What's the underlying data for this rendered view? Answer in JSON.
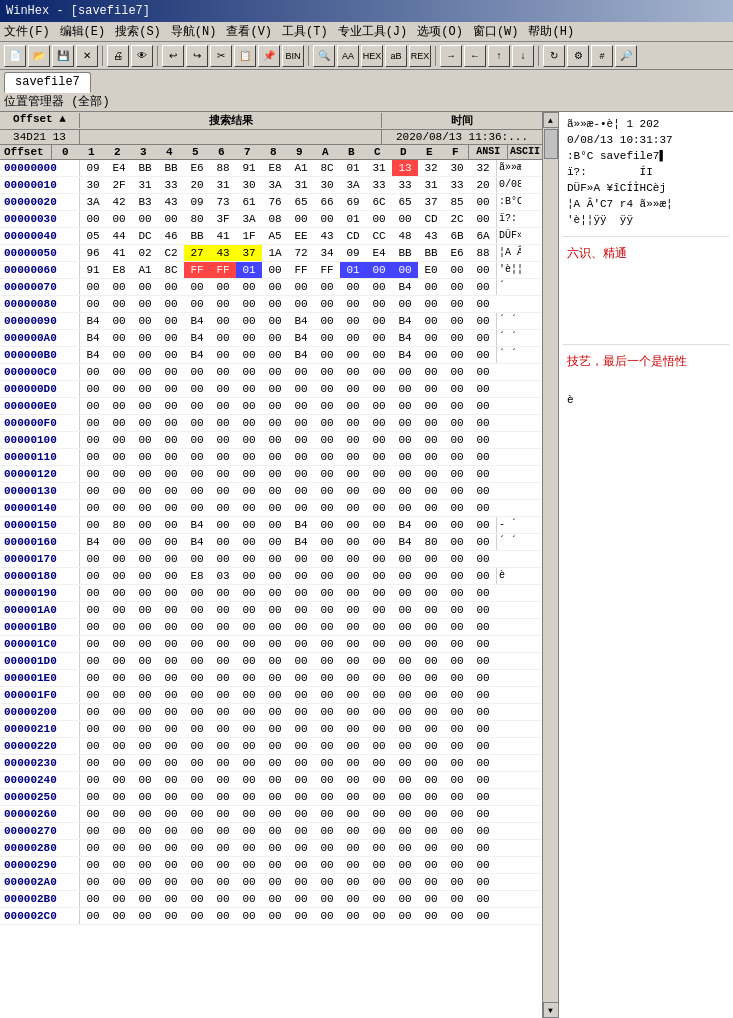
{
  "window": {
    "title": "WinHex - [savefile7]",
    "icon": "📄"
  },
  "menu": {
    "items": [
      "文件(F)",
      "编辑(E)",
      "搜索(S)",
      "导航(N)",
      "查看(V)",
      "工具(T)",
      "专业工具(J)",
      "选项(O)",
      "窗口(W)",
      "帮助(H)"
    ]
  },
  "tab": {
    "label": "savefile7"
  },
  "location_bar": {
    "label": "位置管理器 (全部)"
  },
  "header": {
    "offset_label": "Offset ▲",
    "search_label": "搜索结果",
    "time_label": "时间"
  },
  "subheader": {
    "offset_val": "34D21 13",
    "time_val": "2020/08/13  11:36:..."
  },
  "col_headers": [
    "0",
    "1",
    "2",
    "3",
    "4",
    "5",
    "6",
    "7",
    "8",
    "9",
    "A",
    "B",
    "C",
    "D",
    "E",
    "F"
  ],
  "ansi_label": "ANSI",
  "ascii_label": "ASCII",
  "rows": [
    {
      "offset": "00000000",
      "bytes": [
        "09",
        "E4",
        "BB",
        "BB",
        "E6",
        "88",
        "91",
        "E8",
        "A1",
        "8C",
        "01",
        "31",
        "13",
        "32",
        "30",
        "32"
      ],
      "ansi": "ã»»æ‐•è¦ 1 202",
      "ascii": ""
    },
    {
      "offset": "00000010",
      "bytes": [
        "30",
        "2F",
        "31",
        "33",
        "20",
        "31",
        "30",
        "3A",
        "31",
        "30",
        "3A",
        "33",
        "33",
        "31",
        "33",
        "20"
      ],
      "ansi": "0/08/13 10:31:37",
      "ascii": ""
    },
    {
      "offset": "00000020",
      "bytes": [
        "3A",
        "42",
        "B3",
        "43",
        "09",
        "73",
        "61",
        "76",
        "65",
        "66",
        "69",
        "6C",
        "65",
        "37",
        "85",
        "00"
      ],
      "ansi": ":B°C savefile7▌",
      "ascii": ""
    },
    {
      "offset": "00000030",
      "bytes": [
        "00",
        "00",
        "00",
        "00",
        "80",
        "3F",
        "3A",
        "08",
        "00",
        "00",
        "01",
        "00",
        "00",
        "CD",
        "2C",
        "00"
      ],
      "ansi": "ï?:        ÍI",
      "ascii": ""
    },
    {
      "offset": "00000040",
      "bytes": [
        "05",
        "44",
        "DC",
        "46",
        "BB",
        "41",
        "1F",
        "A5",
        "EE",
        "43",
        "CD",
        "CC",
        "48",
        "43",
        "6B",
        "6A"
      ],
      "ansi": "DÜF»A ¥îCÍÌHCèj",
      "ascii": ""
    },
    {
      "offset": "00000050",
      "bytes": [
        "96",
        "41",
        "02",
        "C2",
        "27",
        "43",
        "37",
        "1A",
        "72",
        "34",
        "09",
        "E4",
        "BB",
        "BB",
        "E6",
        "88"
      ],
      "ansi": "¦A Â'C7 r4 ã»»æ¦",
      "ascii": ""
    },
    {
      "offset": "00000060",
      "bytes": [
        "91",
        "E8",
        "A1",
        "8C",
        "FF",
        "FF",
        "01",
        "00",
        "FF",
        "FF",
        "01",
        "00",
        "00",
        "E0",
        "00",
        "00"
      ],
      "ansi": "'è¦¦ÿÿ  ÿÿ  à  ",
      "ascii": ""
    },
    {
      "offset": "00000070",
      "bytes": [
        "00",
        "00",
        "00",
        "00",
        "00",
        "00",
        "00",
        "00",
        "00",
        "00",
        "00",
        "00",
        "B4",
        "00",
        "00",
        "00"
      ],
      "ansi": "            ´   ",
      "ascii": ""
    },
    {
      "offset": "00000080",
      "bytes": [
        "00",
        "00",
        "00",
        "00",
        "00",
        "00",
        "00",
        "00",
        "00",
        "00",
        "00",
        "00",
        "00",
        "00",
        "00",
        "00"
      ],
      "ansi": "                ",
      "ascii": ""
    },
    {
      "offset": "00000090",
      "bytes": [
        "B4",
        "00",
        "00",
        "00",
        "B4",
        "00",
        "00",
        "00",
        "B4",
        "00",
        "00",
        "00",
        "B4",
        "00",
        "00",
        "00"
      ],
      "ansi": "´   ´   ´   ´   ",
      "ascii": ""
    },
    {
      "offset": "000000A0",
      "bytes": [
        "B4",
        "00",
        "00",
        "00",
        "B4",
        "00",
        "00",
        "00",
        "B4",
        "00",
        "00",
        "00",
        "B4",
        "00",
        "00",
        "00"
      ],
      "ansi": "´   ´   ´   ´   ",
      "ascii": ""
    },
    {
      "offset": "000000B0",
      "bytes": [
        "B4",
        "00",
        "00",
        "00",
        "B4",
        "00",
        "00",
        "00",
        "B4",
        "00",
        "00",
        "00",
        "B4",
        "00",
        "00",
        "00"
      ],
      "ansi": "´   ´   ´   ´   ",
      "ascii": ""
    },
    {
      "offset": "000000C0",
      "bytes": [
        "00",
        "00",
        "00",
        "00",
        "00",
        "00",
        "00",
        "00",
        "00",
        "00",
        "00",
        "00",
        "00",
        "00",
        "00",
        "00"
      ],
      "ansi": "                ",
      "ascii": ""
    },
    {
      "offset": "000000D0",
      "bytes": [
        "00",
        "00",
        "00",
        "00",
        "00",
        "00",
        "00",
        "00",
        "00",
        "00",
        "00",
        "00",
        "00",
        "00",
        "00",
        "00"
      ],
      "ansi": "                ",
      "ascii": ""
    },
    {
      "offset": "000000E0",
      "bytes": [
        "00",
        "00",
        "00",
        "00",
        "00",
        "00",
        "00",
        "00",
        "00",
        "00",
        "00",
        "00",
        "00",
        "00",
        "00",
        "00"
      ],
      "ansi": "                ",
      "ascii": ""
    },
    {
      "offset": "000000F0",
      "bytes": [
        "00",
        "00",
        "00",
        "00",
        "00",
        "00",
        "00",
        "00",
        "00",
        "00",
        "00",
        "00",
        "00",
        "00",
        "00",
        "00"
      ],
      "ansi": "                ",
      "ascii": ""
    },
    {
      "offset": "00000100",
      "bytes": [
        "00",
        "00",
        "00",
        "00",
        "00",
        "00",
        "00",
        "00",
        "00",
        "00",
        "00",
        "00",
        "00",
        "00",
        "00",
        "00"
      ],
      "ansi": "                ",
      "ascii": ""
    },
    {
      "offset": "00000110",
      "bytes": [
        "00",
        "00",
        "00",
        "00",
        "00",
        "00",
        "00",
        "00",
        "00",
        "00",
        "00",
        "00",
        "00",
        "00",
        "00",
        "00"
      ],
      "ansi": "                ",
      "ascii": ""
    },
    {
      "offset": "00000120",
      "bytes": [
        "00",
        "00",
        "00",
        "00",
        "00",
        "00",
        "00",
        "00",
        "00",
        "00",
        "00",
        "00",
        "00",
        "00",
        "00",
        "00"
      ],
      "ansi": "                ",
      "ascii": ""
    },
    {
      "offset": "00000130",
      "bytes": [
        "00",
        "00",
        "00",
        "00",
        "00",
        "00",
        "00",
        "00",
        "00",
        "00",
        "00",
        "00",
        "00",
        "00",
        "00",
        "00"
      ],
      "ansi": "                ",
      "ascii": ""
    },
    {
      "offset": "00000140",
      "bytes": [
        "00",
        "00",
        "00",
        "00",
        "00",
        "00",
        "00",
        "00",
        "00",
        "00",
        "00",
        "00",
        "00",
        "00",
        "00",
        "00"
      ],
      "ansi": "                ",
      "ascii": ""
    },
    {
      "offset": "00000150",
      "bytes": [
        "00",
        "80",
        "00",
        "00",
        "B4",
        "00",
        "00",
        "00",
        "B4",
        "00",
        "00",
        "00",
        "B4",
        "00",
        "00",
        "00"
      ],
      "ansi": " ‐  ´   ´   ´   ",
      "ascii": ""
    },
    {
      "offset": "00000160",
      "bytes": [
        "B4",
        "00",
        "00",
        "00",
        "B4",
        "00",
        "00",
        "00",
        "B4",
        "00",
        "00",
        "00",
        "B4",
        "80",
        "00",
        "00"
      ],
      "ansi": "´   ´   ´   ´‐  ",
      "ascii": ""
    },
    {
      "offset": "00000170",
      "bytes": [
        "00",
        "00",
        "00",
        "00",
        "00",
        "00",
        "00",
        "00",
        "00",
        "00",
        "00",
        "00",
        "00",
        "00",
        "00",
        "00"
      ],
      "ansi": "                ",
      "ascii": ""
    },
    {
      "offset": "00000180",
      "bytes": [
        "00",
        "00",
        "00",
        "00",
        "E8",
        "03",
        "00",
        "00",
        "00",
        "00",
        "00",
        "00",
        "00",
        "00",
        "00",
        "00"
      ],
      "ansi": "    è           ",
      "ascii": ""
    },
    {
      "offset": "00000190",
      "bytes": [
        "00",
        "00",
        "00",
        "00",
        "00",
        "00",
        "00",
        "00",
        "00",
        "00",
        "00",
        "00",
        "00",
        "00",
        "00",
        "00"
      ],
      "ansi": "                ",
      "ascii": ""
    },
    {
      "offset": "000001A0",
      "bytes": [
        "00",
        "00",
        "00",
        "00",
        "00",
        "00",
        "00",
        "00",
        "00",
        "00",
        "00",
        "00",
        "00",
        "00",
        "00",
        "00"
      ],
      "ansi": "                ",
      "ascii": ""
    },
    {
      "offset": "000001B0",
      "bytes": [
        "00",
        "00",
        "00",
        "00",
        "00",
        "00",
        "00",
        "00",
        "00",
        "00",
        "00",
        "00",
        "00",
        "00",
        "00",
        "00"
      ],
      "ansi": "                ",
      "ascii": ""
    },
    {
      "offset": "000001C0",
      "bytes": [
        "00",
        "00",
        "00",
        "00",
        "00",
        "00",
        "00",
        "00",
        "00",
        "00",
        "00",
        "00",
        "00",
        "00",
        "00",
        "00"
      ],
      "ansi": "                ",
      "ascii": ""
    },
    {
      "offset": "000001D0",
      "bytes": [
        "00",
        "00",
        "00",
        "00",
        "00",
        "00",
        "00",
        "00",
        "00",
        "00",
        "00",
        "00",
        "00",
        "00",
        "00",
        "00"
      ],
      "ansi": "                ",
      "ascii": ""
    },
    {
      "offset": "000001E0",
      "bytes": [
        "00",
        "00",
        "00",
        "00",
        "00",
        "00",
        "00",
        "00",
        "00",
        "00",
        "00",
        "00",
        "00",
        "00",
        "00",
        "00"
      ],
      "ansi": "                ",
      "ascii": ""
    },
    {
      "offset": "000001F0",
      "bytes": [
        "00",
        "00",
        "00",
        "00",
        "00",
        "00",
        "00",
        "00",
        "00",
        "00",
        "00",
        "00",
        "00",
        "00",
        "00",
        "00"
      ],
      "ansi": "                ",
      "ascii": ""
    },
    {
      "offset": "00000200",
      "bytes": [
        "00",
        "00",
        "00",
        "00",
        "00",
        "00",
        "00",
        "00",
        "00",
        "00",
        "00",
        "00",
        "00",
        "00",
        "00",
        "00"
      ],
      "ansi": "                ",
      "ascii": ""
    },
    {
      "offset": "00000210",
      "bytes": [
        "00",
        "00",
        "00",
        "00",
        "00",
        "00",
        "00",
        "00",
        "00",
        "00",
        "00",
        "00",
        "00",
        "00",
        "00",
        "00"
      ],
      "ansi": "                ",
      "ascii": ""
    },
    {
      "offset": "00000220",
      "bytes": [
        "00",
        "00",
        "00",
        "00",
        "00",
        "00",
        "00",
        "00",
        "00",
        "00",
        "00",
        "00",
        "00",
        "00",
        "00",
        "00"
      ],
      "ansi": "                ",
      "ascii": ""
    },
    {
      "offset": "00000230",
      "bytes": [
        "00",
        "00",
        "00",
        "00",
        "00",
        "00",
        "00",
        "00",
        "00",
        "00",
        "00",
        "00",
        "00",
        "00",
        "00",
        "00"
      ],
      "ansi": "                ",
      "ascii": ""
    },
    {
      "offset": "00000240",
      "bytes": [
        "00",
        "00",
        "00",
        "00",
        "00",
        "00",
        "00",
        "00",
        "00",
        "00",
        "00",
        "00",
        "00",
        "00",
        "00",
        "00"
      ],
      "ansi": "                ",
      "ascii": ""
    },
    {
      "offset": "00000250",
      "bytes": [
        "00",
        "00",
        "00",
        "00",
        "00",
        "00",
        "00",
        "00",
        "00",
        "00",
        "00",
        "00",
        "00",
        "00",
        "00",
        "00"
      ],
      "ansi": "                ",
      "ascii": ""
    },
    {
      "offset": "00000260",
      "bytes": [
        "00",
        "00",
        "00",
        "00",
        "00",
        "00",
        "00",
        "00",
        "00",
        "00",
        "00",
        "00",
        "00",
        "00",
        "00",
        "00"
      ],
      "ansi": "                ",
      "ascii": ""
    },
    {
      "offset": "00000270",
      "bytes": [
        "00",
        "00",
        "00",
        "00",
        "00",
        "00",
        "00",
        "00",
        "00",
        "00",
        "00",
        "00",
        "00",
        "00",
        "00",
        "00"
      ],
      "ansi": "                ",
      "ascii": ""
    },
    {
      "offset": "00000280",
      "bytes": [
        "00",
        "00",
        "00",
        "00",
        "00",
        "00",
        "00",
        "00",
        "00",
        "00",
        "00",
        "00",
        "00",
        "00",
        "00",
        "00"
      ],
      "ansi": "                ",
      "ascii": ""
    },
    {
      "offset": "00000290",
      "bytes": [
        "00",
        "00",
        "00",
        "00",
        "00",
        "00",
        "00",
        "00",
        "00",
        "00",
        "00",
        "00",
        "00",
        "00",
        "00",
        "00"
      ],
      "ansi": "                ",
      "ascii": ""
    },
    {
      "offset": "000002A0",
      "bytes": [
        "00",
        "00",
        "00",
        "00",
        "00",
        "00",
        "00",
        "00",
        "00",
        "00",
        "00",
        "00",
        "00",
        "00",
        "00",
        "00"
      ],
      "ansi": "                ",
      "ascii": ""
    },
    {
      "offset": "000002B0",
      "bytes": [
        "00",
        "00",
        "00",
        "00",
        "00",
        "00",
        "00",
        "00",
        "00",
        "00",
        "00",
        "00",
        "00",
        "00",
        "00",
        "00"
      ],
      "ansi": "                ",
      "ascii": ""
    },
    {
      "offset": "000002C0",
      "bytes": [
        "00",
        "00",
        "00",
        "00",
        "00",
        "00",
        "00",
        "00",
        "00",
        "00",
        "00",
        "00",
        "00",
        "00",
        "00",
        "00"
      ],
      "ansi": "                ",
      "ascii": ""
    }
  ],
  "highlights": {
    "row0_col12": "red",
    "row5_col4": "yellow",
    "row5_col5": "yellow",
    "row5_col6": "yellow",
    "row6_col4": "red",
    "row6_col5": "red",
    "row6_col6": "blue",
    "row6_col10": "blue",
    "row6_col11": "blue",
    "row6_col12": "blue"
  },
  "side_panel": {
    "section1_text": "ã»»æ‐•è¦ 1 202",
    "section2_text": "0/08/13 10:31:37",
    "section3_text": ":B°C savefile7▌",
    "section4_text": "ï?:        ÍI",
    "section5_text": "DÜF»A ¥îCÍÌHCèj",
    "section6_text": "¦A Â'C7 r4 ã»»æ¦",
    "section7_text": "'è¦¦ÿÿ  ÿÿ",
    "comment1": "六识、精通",
    "comment1_color": "#cc0000",
    "comment2": "技艺，最后一个是悟性",
    "comment2_color": "#cc0000",
    "comment3": "è",
    "comment3_color": "#000"
  }
}
